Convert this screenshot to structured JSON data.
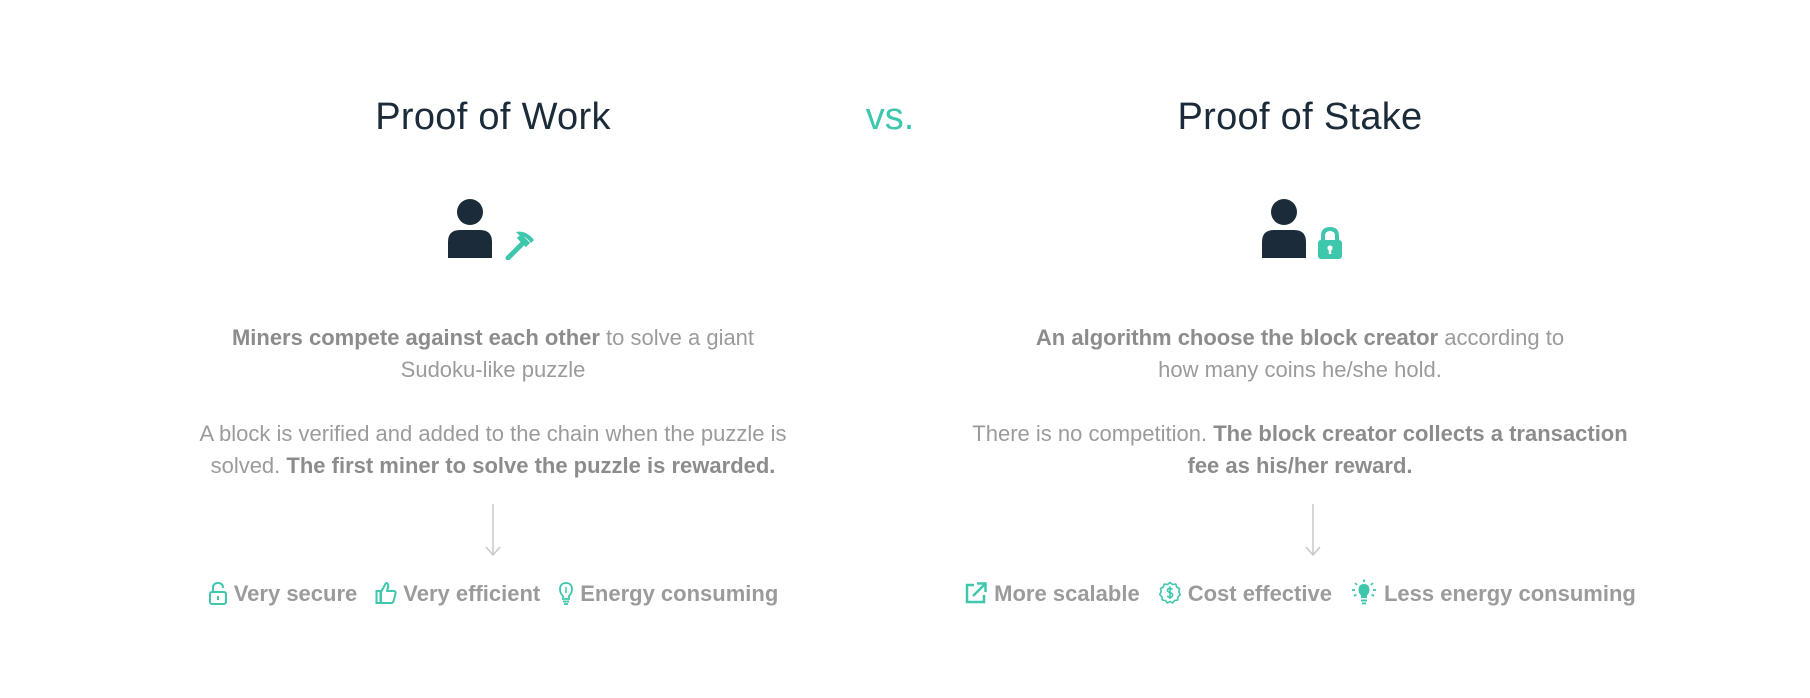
{
  "comparison": {
    "vs_label": "vs.",
    "left": {
      "title": "Proof of Work",
      "icons": [
        "user-icon",
        "pickaxe-icon"
      ],
      "p1_bold": "Miners compete against each other",
      "p1_rest_line1": " to solve a giant",
      "p1_rest_line2": "Sudoku-like puzzle",
      "p2_line1": "A block is verified and added to the chain when the puzzle is",
      "p2_line2_plain": "solved. ",
      "p2_line2_bold": "The first miner to solve the puzzle is rewarded.",
      "features": [
        {
          "icon": "lock-open-icon",
          "label": "Very secure"
        },
        {
          "icon": "thumbs-up-icon",
          "label": "Very efficient"
        },
        {
          "icon": "lightbulb-icon",
          "label": "Energy consuming"
        }
      ]
    },
    "right": {
      "title": "Proof of Stake",
      "icons": [
        "user-icon",
        "lock-icon"
      ],
      "p1_bold": "An algorithm choose the block creator",
      "p1_rest_line1": " according to",
      "p1_rest_line2": "how many coins he/she hold.",
      "p2_line1_plain": "There is no competition. ",
      "p2_line1_bold": "The block creator collects a transaction",
      "p2_line2_bold": "fee as his/her reward.",
      "features": [
        {
          "icon": "external-link-icon",
          "label": "More scalable"
        },
        {
          "icon": "dollar-badge-icon",
          "label": "Cost effective"
        },
        {
          "icon": "lightbulb-bright-icon",
          "label": "Less energy consuming"
        }
      ]
    }
  },
  "colors": {
    "title": "#1b2b3a",
    "accent": "#3ec7ad",
    "text_gray": "#9b9b9b",
    "arrow_gray": "#c8c8c8"
  }
}
